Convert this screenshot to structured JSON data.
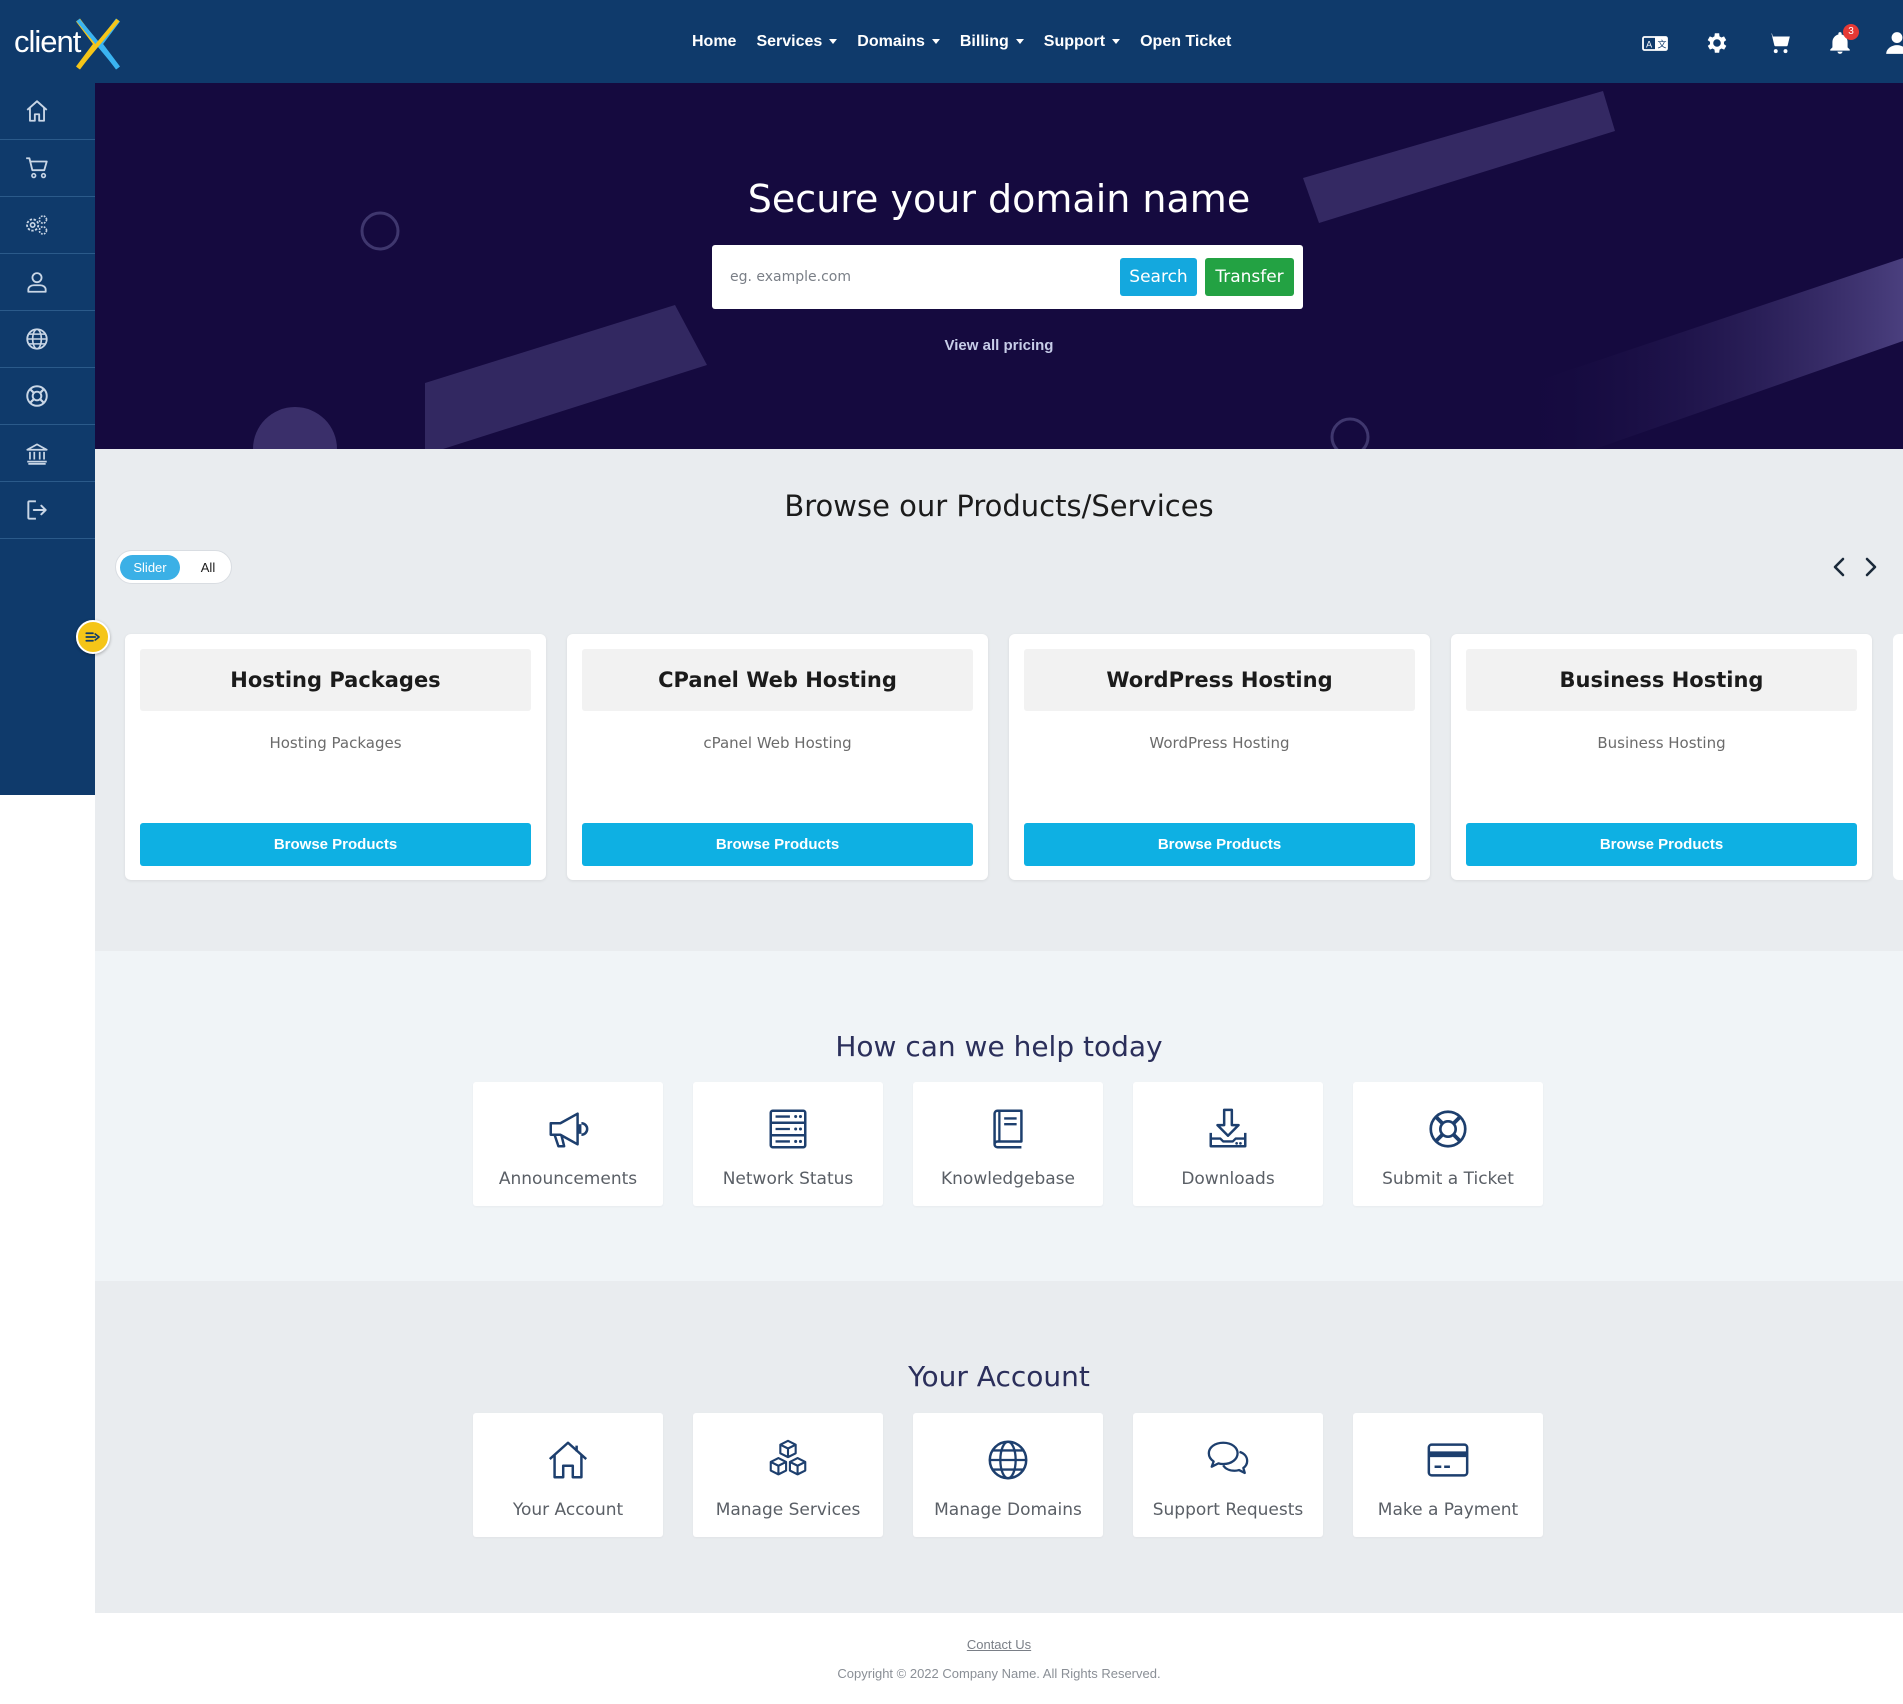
{
  "brand": {
    "logo_text": "client",
    "accent": "#f5c518",
    "primary": "#0f3a6b",
    "hero_bg": "#150a3f"
  },
  "nav": {
    "items": [
      {
        "label": "Home",
        "dropdown": false
      },
      {
        "label": "Services",
        "dropdown": true
      },
      {
        "label": "Domains",
        "dropdown": true
      },
      {
        "label": "Billing",
        "dropdown": true
      },
      {
        "label": "Support",
        "dropdown": true
      },
      {
        "label": "Open Ticket",
        "dropdown": false
      }
    ]
  },
  "header_icons": [
    "translate-icon",
    "gear-icon",
    "cart-icon",
    "bell-icon",
    "user-icon"
  ],
  "notifications": {
    "count": "3"
  },
  "sidebar": {
    "icons": [
      "home-icon",
      "cart-icon",
      "services-gears-icon",
      "user-icon",
      "globe-icon",
      "support-lifebuoy-icon",
      "bank-icon",
      "logout-icon"
    ]
  },
  "hero": {
    "title": "Secure your domain name",
    "search_placeholder": "eg. example.com",
    "search_label": "Search",
    "transfer_label": "Transfer",
    "pricing_link": "View all pricing"
  },
  "browse": {
    "title": "Browse our Products/Services",
    "toggle_slider": "Slider",
    "toggle_all": "All",
    "cards": [
      {
        "title": "Hosting Packages",
        "desc": "Hosting Packages",
        "button": "Browse Products"
      },
      {
        "title": "CPanel Web Hosting",
        "desc": "cPanel Web Hosting",
        "button": "Browse Products"
      },
      {
        "title": "WordPress Hosting",
        "desc": "WordPress Hosting",
        "button": "Browse Products"
      },
      {
        "title": "Business Hosting",
        "desc": "Business Hosting",
        "button": "Browse Products"
      }
    ]
  },
  "help": {
    "title": "How can we help today",
    "tiles": [
      {
        "label": "Announcements",
        "icon": "megaphone-icon"
      },
      {
        "label": "Network Status",
        "icon": "server-icon"
      },
      {
        "label": "Knowledgebase",
        "icon": "book-icon"
      },
      {
        "label": "Downloads",
        "icon": "download-icon"
      },
      {
        "label": "Submit a Ticket",
        "icon": "lifebuoy-icon"
      }
    ]
  },
  "account": {
    "title": "Your Account",
    "tiles": [
      {
        "label": "Your Account",
        "icon": "home-icon"
      },
      {
        "label": "Manage Services",
        "icon": "boxes-icon"
      },
      {
        "label": "Manage Domains",
        "icon": "globe-icon"
      },
      {
        "label": "Support Requests",
        "icon": "chat-icon"
      },
      {
        "label": "Make a Payment",
        "icon": "credit-card-icon"
      }
    ]
  },
  "footer": {
    "contact": "Contact Us",
    "copyright": "Copyright © 2022 Company Name. All Rights Reserved."
  }
}
